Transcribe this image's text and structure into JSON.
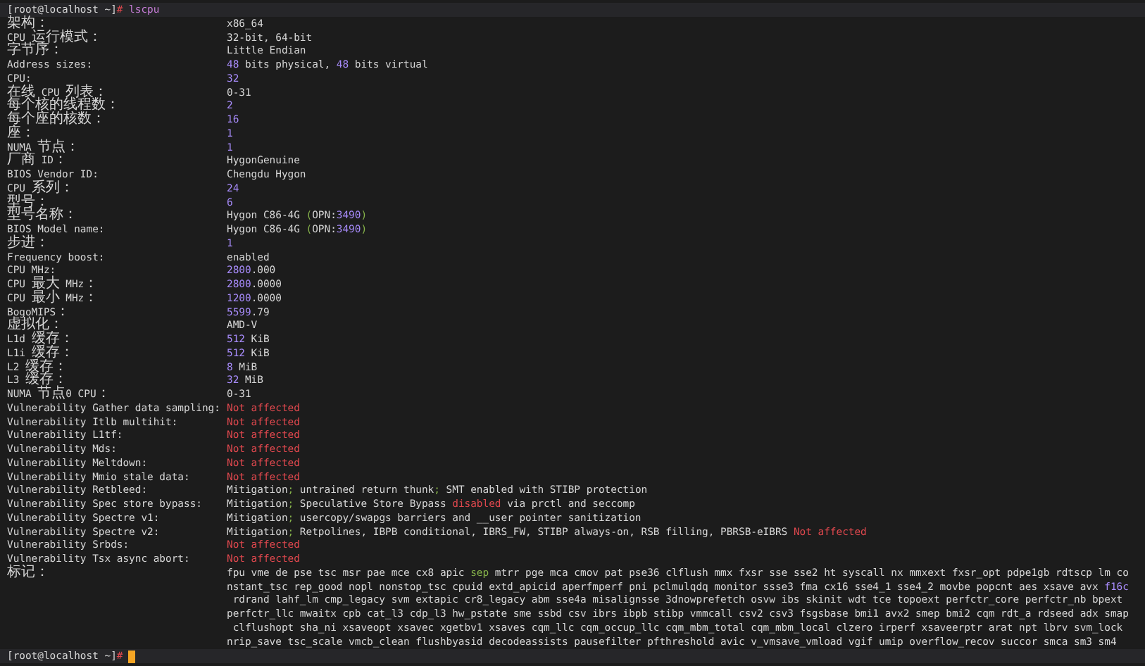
{
  "prompt": {
    "user_host": "[root@localhost ~]",
    "symbol": "#",
    "command": " lscpu"
  },
  "rows": [
    {
      "label": "架构：",
      "value": [
        {
          "text": "x86_64",
          "kind": "plain"
        }
      ]
    },
    {
      "label": "CPU 运行模式：",
      "value": [
        {
          "text": "32-bit, 64-bit",
          "kind": "plain"
        }
      ]
    },
    {
      "label": "字节序：",
      "value": [
        {
          "text": "Little Endian",
          "kind": "plain"
        }
      ]
    },
    {
      "label": "Address sizes:",
      "value": [
        {
          "text": "48",
          "kind": "number"
        },
        {
          "text": " bits physical, ",
          "kind": "plain"
        },
        {
          "text": "48",
          "kind": "number"
        },
        {
          "text": " bits virtual",
          "kind": "plain"
        }
      ]
    },
    {
      "label": "CPU:",
      "value": [
        {
          "text": "32",
          "kind": "number"
        }
      ]
    },
    {
      "label": "在线 CPU 列表：",
      "value": [
        {
          "text": "0-31",
          "kind": "plain"
        }
      ]
    },
    {
      "label": "每个核的线程数：",
      "value": [
        {
          "text": "2",
          "kind": "number"
        }
      ]
    },
    {
      "label": "每个座的核数：",
      "value": [
        {
          "text": "16",
          "kind": "number"
        }
      ]
    },
    {
      "label": "座：",
      "value": [
        {
          "text": "1",
          "kind": "number"
        }
      ]
    },
    {
      "label": "NUMA 节点：",
      "value": [
        {
          "text": "1",
          "kind": "number"
        }
      ]
    },
    {
      "label": "厂商 ID：",
      "value": [
        {
          "text": "HygonGenuine",
          "kind": "plain"
        }
      ]
    },
    {
      "label": "BIOS Vendor ID:",
      "value": [
        {
          "text": "Chengdu Hygon",
          "kind": "plain"
        }
      ]
    },
    {
      "label": "CPU 系列：",
      "value": [
        {
          "text": "24",
          "kind": "number"
        }
      ]
    },
    {
      "label": "型号：",
      "value": [
        {
          "text": "6",
          "kind": "number"
        }
      ]
    },
    {
      "label": "型号名称：",
      "value": [
        {
          "text": "Hygon C86-4G ",
          "kind": "plain"
        },
        {
          "text": "(",
          "kind": "punct"
        },
        {
          "text": "OPN:",
          "kind": "plain"
        },
        {
          "text": "3490",
          "kind": "number"
        },
        {
          "text": ")",
          "kind": "punct"
        }
      ]
    },
    {
      "label": "BIOS Model name:",
      "value": [
        {
          "text": "Hygon C86-4G ",
          "kind": "plain"
        },
        {
          "text": "(",
          "kind": "punct"
        },
        {
          "text": "OPN:",
          "kind": "plain"
        },
        {
          "text": "3490",
          "kind": "number"
        },
        {
          "text": ")",
          "kind": "punct"
        }
      ]
    },
    {
      "label": "步进：",
      "value": [
        {
          "text": "1",
          "kind": "number"
        }
      ]
    },
    {
      "label": "Frequency boost:",
      "value": [
        {
          "text": "enabled",
          "kind": "plain"
        }
      ]
    },
    {
      "label": "CPU MHz:",
      "value": [
        {
          "text": "2800",
          "kind": "number"
        },
        {
          "text": ".000",
          "kind": "plain"
        }
      ]
    },
    {
      "label": "CPU 最大 MHz：",
      "value": [
        {
          "text": "2800",
          "kind": "number"
        },
        {
          "text": ".0000",
          "kind": "plain"
        }
      ]
    },
    {
      "label": "CPU 最小 MHz：",
      "value": [
        {
          "text": "1200",
          "kind": "number"
        },
        {
          "text": ".0000",
          "kind": "plain"
        }
      ]
    },
    {
      "label": "BogoMIPS：",
      "value": [
        {
          "text": "5599",
          "kind": "number"
        },
        {
          "text": ".79",
          "kind": "plain"
        }
      ]
    },
    {
      "label": "虚拟化：",
      "value": [
        {
          "text": "AMD-V",
          "kind": "plain"
        }
      ]
    },
    {
      "label": "L1d 缓存：",
      "value": [
        {
          "text": "512",
          "kind": "number"
        },
        {
          "text": " KiB",
          "kind": "plain"
        }
      ]
    },
    {
      "label": "L1i 缓存：",
      "value": [
        {
          "text": "512",
          "kind": "number"
        },
        {
          "text": " KiB",
          "kind": "plain"
        }
      ]
    },
    {
      "label": "L2 缓存：",
      "value": [
        {
          "text": "8",
          "kind": "number"
        },
        {
          "text": " MiB",
          "kind": "plain"
        }
      ]
    },
    {
      "label": "L3 缓存：",
      "value": [
        {
          "text": "32",
          "kind": "number"
        },
        {
          "text": " MiB",
          "kind": "plain"
        }
      ]
    },
    {
      "label": "NUMA 节点0 CPU：",
      "value": [
        {
          "text": "0-31",
          "kind": "plain"
        }
      ]
    },
    {
      "label": "Vulnerability Gather data sampling:",
      "value": [
        {
          "text": "Not affected",
          "kind": "alert"
        }
      ]
    },
    {
      "label": "Vulnerability Itlb multihit:",
      "value": [
        {
          "text": "Not affected",
          "kind": "alert"
        }
      ]
    },
    {
      "label": "Vulnerability L1tf:",
      "value": [
        {
          "text": "Not affected",
          "kind": "alert"
        }
      ]
    },
    {
      "label": "Vulnerability Mds:",
      "value": [
        {
          "text": "Not affected",
          "kind": "alert"
        }
      ]
    },
    {
      "label": "Vulnerability Meltdown:",
      "value": [
        {
          "text": "Not affected",
          "kind": "alert"
        }
      ]
    },
    {
      "label": "Vulnerability Mmio stale data:",
      "value": [
        {
          "text": "Not affected",
          "kind": "alert"
        }
      ]
    },
    {
      "label": "Vulnerability Retbleed:",
      "value": [
        {
          "text": "Mitigation",
          "kind": "plain"
        },
        {
          "text": ";",
          "kind": "punct"
        },
        {
          "text": " untrained return thunk",
          "kind": "plain"
        },
        {
          "text": ";",
          "kind": "punct"
        },
        {
          "text": " SMT enabled with STIBP protection",
          "kind": "plain"
        }
      ]
    },
    {
      "label": "Vulnerability Spec store bypass:",
      "value": [
        {
          "text": "Mitigation",
          "kind": "plain"
        },
        {
          "text": ";",
          "kind": "punct"
        },
        {
          "text": " Speculative Store Bypass ",
          "kind": "plain"
        },
        {
          "text": "disabled",
          "kind": "alert"
        },
        {
          "text": " via prctl and seccomp",
          "kind": "plain"
        }
      ]
    },
    {
      "label": "Vulnerability Spectre v1:",
      "value": [
        {
          "text": "Mitigation",
          "kind": "plain"
        },
        {
          "text": ";",
          "kind": "punct"
        },
        {
          "text": " usercopy/swapgs barriers and __user pointer sanitization",
          "kind": "plain"
        }
      ]
    },
    {
      "label": "Vulnerability Spectre v2:",
      "value": [
        {
          "text": "Mitigation",
          "kind": "plain"
        },
        {
          "text": ";",
          "kind": "punct"
        },
        {
          "text": " Retpolines, IBPB conditional, IBRS_FW, STIBP always-on, RSB filling, PBRSB-eIBRS ",
          "kind": "plain"
        },
        {
          "text": "Not affected",
          "kind": "alert"
        }
      ]
    },
    {
      "label": "Vulnerability Srbds:",
      "value": [
        {
          "text": "Not affected",
          "kind": "alert"
        }
      ]
    },
    {
      "label": "Vulnerability Tsx async abort:",
      "value": [
        {
          "text": "Not affected",
          "kind": "alert"
        }
      ]
    },
    {
      "label": "标记：",
      "value": [
        {
          "text": "fpu vme de pse tsc msr pae mce cx8 apic ",
          "kind": "plain"
        },
        {
          "text": "sep",
          "kind": "punct"
        },
        {
          "text": " mtrr pge mca cmov pat pse36 clflush mmx fxsr sse sse2 ht syscall nx mmxext fxsr_opt pdpe1gb rdtscp lm co",
          "kind": "plain"
        }
      ]
    }
  ],
  "flag_lines": [
    [
      {
        "text": "nstant_tsc rep_good nopl nonstop_tsc cpuid extd_apicid aperfmperf pni pclmulqdq monitor ssse3 fma cx16 sse4_1 sse4_2 movbe popcnt aes xsave avx ",
        "kind": "plain"
      },
      {
        "text": "f16c",
        "kind": "number"
      }
    ],
    [
      {
        "text": " rdrand lahf_lm cmp_legacy svm extapic cr8_legacy abm sse4a misalignsse 3dnowprefetch osvw ibs skinit wdt tce topoext perfctr_core perfctr_nb bpext",
        "kind": "plain"
      }
    ],
    [
      {
        "text": "perfctr_llc mwaitx cpb cat_l3 cdp_l3 hw_pstate sme ssbd csv ibrs ibpb stibp vmmcall csv2 csv3 fsgsbase bmi1 avx2 smep bmi2 cqm rdt_a rdseed adx smap",
        "kind": "plain"
      }
    ],
    [
      {
        "text": " clflushopt sha_ni xsaveopt xsavec xgetbv1 xsaves cqm_llc cqm_occup_llc cqm_mbm_total cqm_mbm_local clzero irperf xsaveerptr arat npt lbrv svm_lock",
        "kind": "plain"
      }
    ],
    [
      {
        "text": "nrip_save tsc_scale vmcb_clean flushbyasid decodeassists pausefilter pfthreshold avic v_vmsave_vmload vgif umip overflow_recov succor smca sm3 sm4",
        "kind": "plain"
      }
    ]
  ],
  "bottom_prompt": {
    "user_host": "[root@localhost ~]",
    "symbol": "#"
  }
}
